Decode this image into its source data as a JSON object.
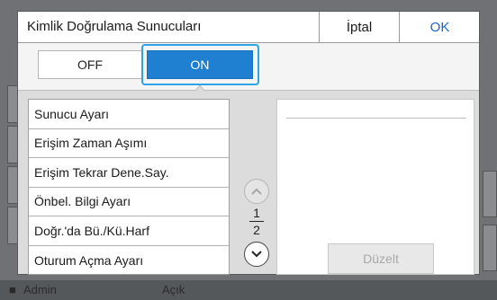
{
  "dialog": {
    "title": "Kimlik Doğrulama Sunucuları",
    "cancel_label": "İptal",
    "ok_label": "OK"
  },
  "toggle": {
    "off_label": "OFF",
    "on_label": "ON",
    "selected": "ON"
  },
  "menu": {
    "items": [
      {
        "label": "Sunucu Ayarı"
      },
      {
        "label": "Erişim Zaman Aşımı"
      },
      {
        "label": "Erişim Tekrar Dene.Say."
      },
      {
        "label": "Önbel. Bilgi Ayarı"
      },
      {
        "label": "Doğr.'da Bü./Kü.Harf"
      },
      {
        "label": "Oturum Açma Ayarı"
      }
    ]
  },
  "pager": {
    "current": "1",
    "total": "2",
    "up_icon": "chevron-up-icon",
    "down_icon": "chevron-down-icon"
  },
  "panel": {
    "edit_label": "Düzelt"
  },
  "background": {
    "user_label": "Admin",
    "status_label": "Açık"
  },
  "colors": {
    "accent": "#1f7fd1",
    "highlight": "#2ea3e6",
    "ok_text": "#1a63c7"
  }
}
